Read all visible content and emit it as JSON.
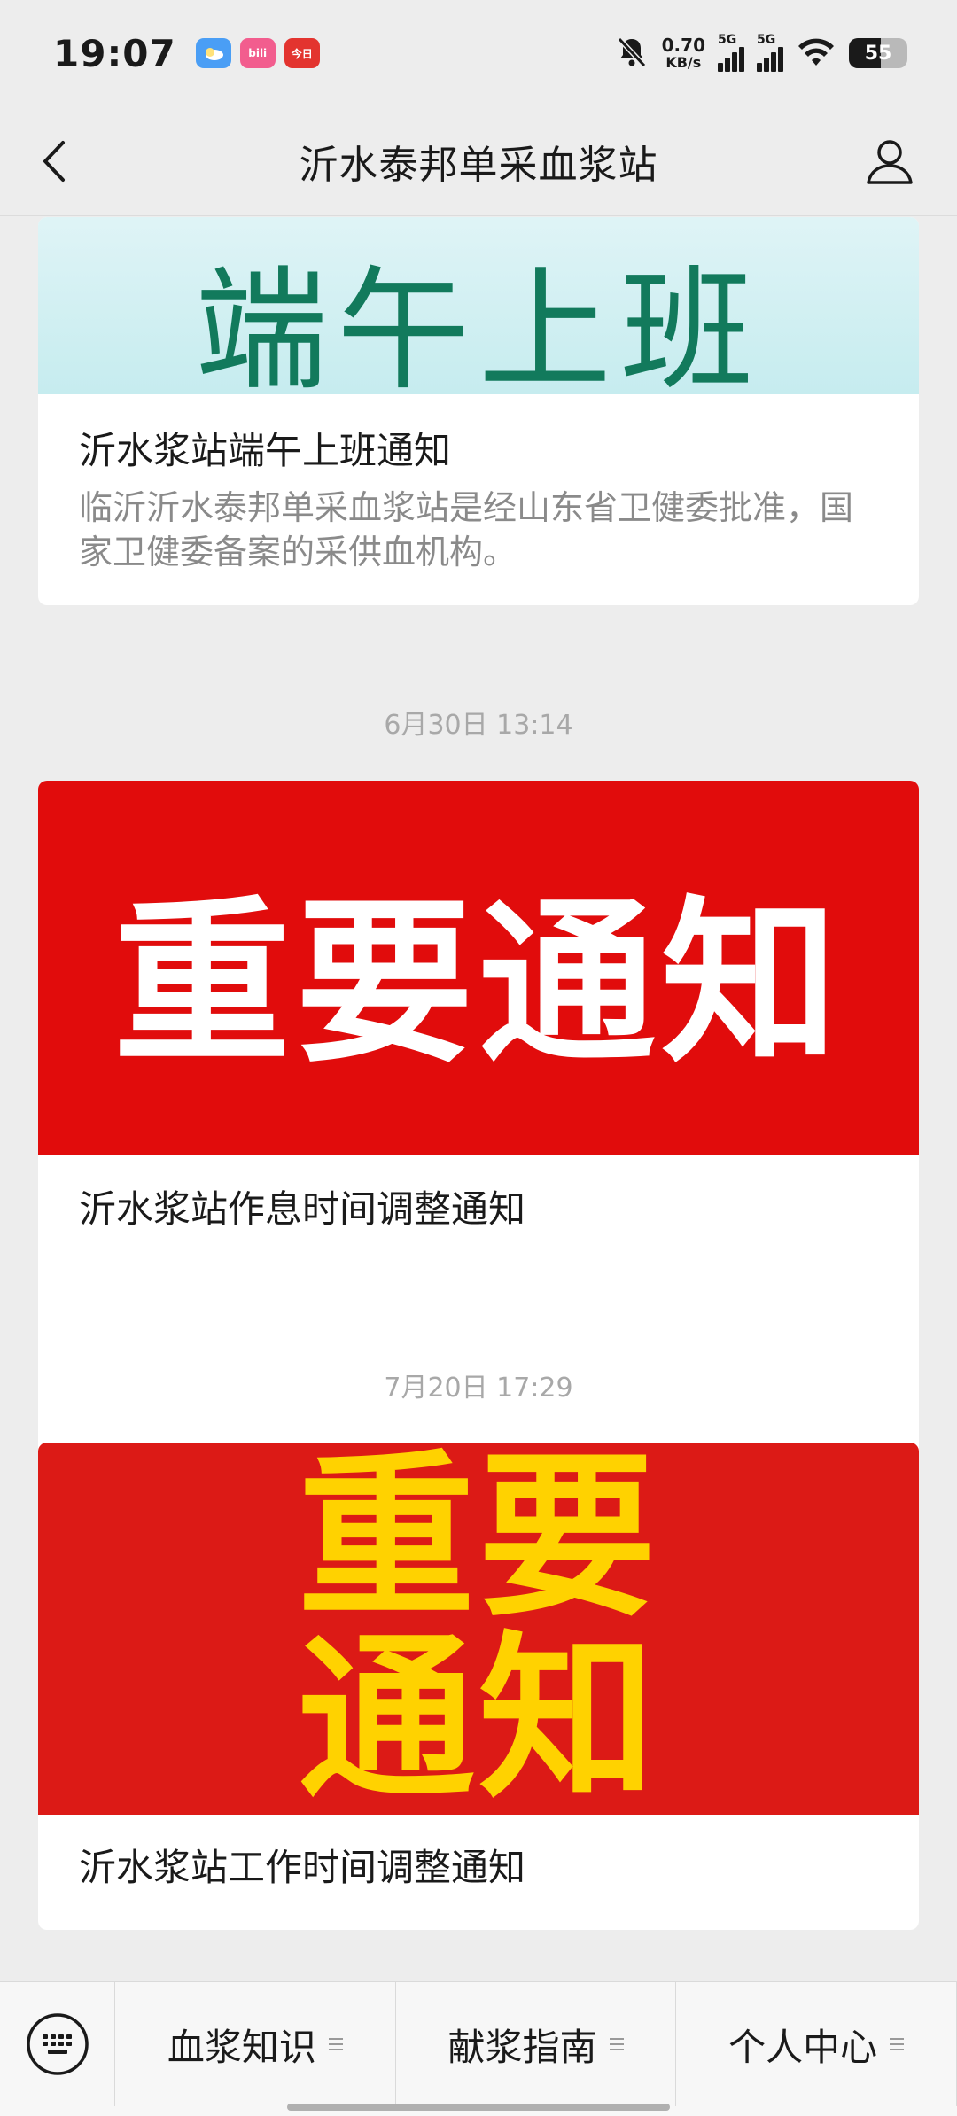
{
  "status_bar": {
    "time": "19:07",
    "apps": [
      {
        "icon": "weather-icon",
        "label": ""
      },
      {
        "icon": "bilibili-icon",
        "label": "bili"
      },
      {
        "icon": "news-app-icon",
        "label": "今日"
      }
    ],
    "net_speed_value": "0.70",
    "net_speed_unit": "KB/s",
    "signal_1_label": "5G",
    "signal_2_label": "5G",
    "battery_level": "55"
  },
  "header": {
    "title": "沂水泰邦单采血浆站",
    "back_icon": "chevron-left-icon",
    "profile_icon": "user-icon"
  },
  "feed": {
    "items": [
      {
        "image_text": "端午上班",
        "title": "沂水浆站端午上班通知",
        "description": "临沂沂水泰邦单采血浆站是经山东省卫健委批准，国家卫健委备案的采供血机构。"
      },
      {
        "timestamp": "6月30日 13:14",
        "image_text": "重要通知",
        "title": "沂水浆站作息时间调整通知"
      },
      {
        "timestamp": "7月20日 17:29",
        "image_text_line1": "重要",
        "image_text_line2": "通知",
        "title": "沂水浆站工作时间调整通知"
      }
    ]
  },
  "bottom_menu": {
    "keyboard_icon": "keyboard-icon",
    "items": [
      {
        "label": "血浆知识"
      },
      {
        "label": "献浆指南"
      },
      {
        "label": "个人中心"
      }
    ]
  },
  "colors": {
    "background": "#ededed",
    "card": "#ffffff",
    "card1_bg": "#d3f0f2",
    "card1_text": "#127a5c",
    "card2_bg": "#e10c0c",
    "card3_bg": "#dc1a16",
    "card3_text": "#ffd200"
  }
}
